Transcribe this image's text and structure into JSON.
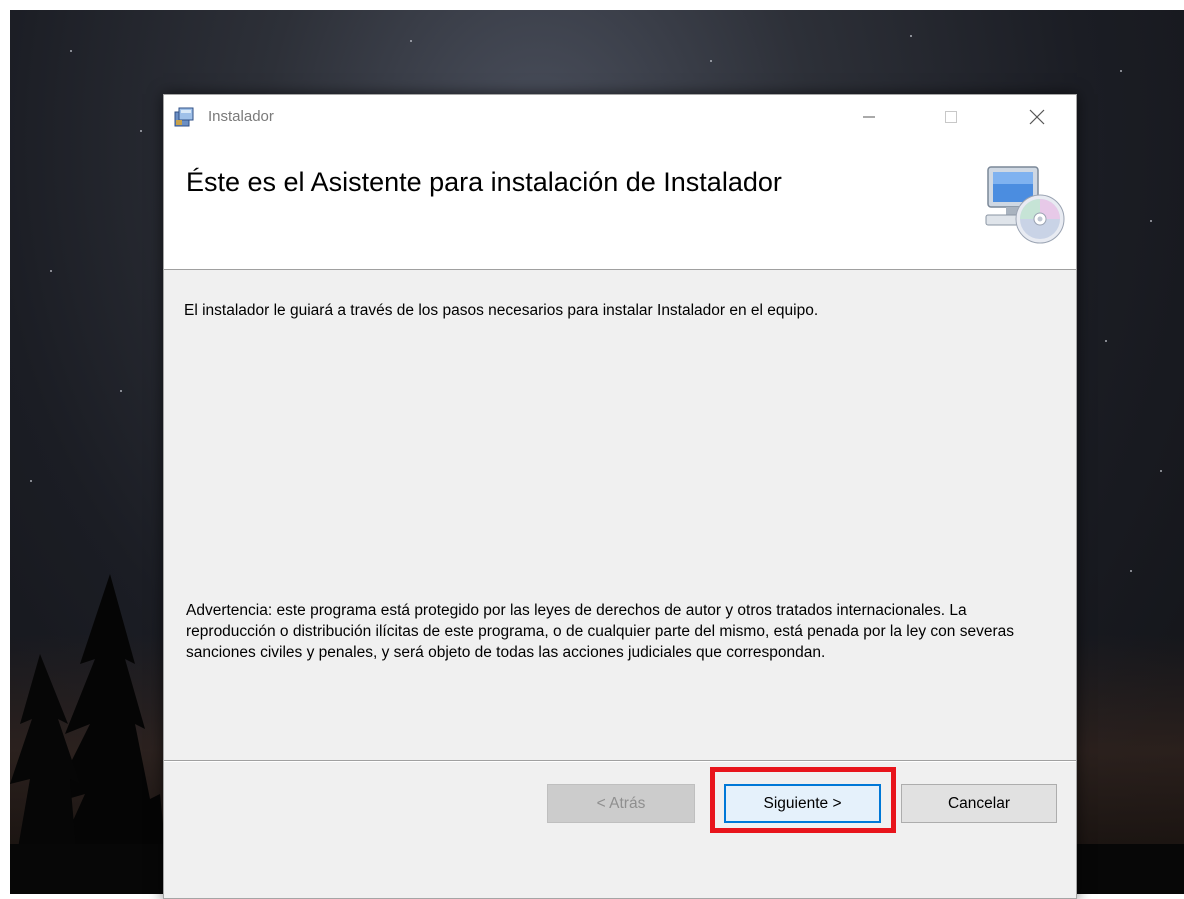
{
  "window": {
    "title": "Instalador",
    "heading": "Éste es el Asistente para instalación de Instalador",
    "intro": "El instalador le guiará a través de los pasos necesarios para instalar Instalador en el equipo.",
    "warning": "Advertencia: este programa está protegido por las leyes de derechos de autor y otros tratados internacionales. La reproducción o distribución ilícitas de este programa, o de cualquier parte del mismo, está penada por la ley con severas sanciones civiles y penales, y será objeto de todas las acciones judiciales que correspondan."
  },
  "buttons": {
    "back": "< Atrás",
    "next": "Siguiente >",
    "cancel": "Cancelar"
  },
  "colors": {
    "highlight": "#e8141b",
    "focus_border": "#0078d7"
  },
  "icons": {
    "app": "installer-package-icon",
    "header": "computer-cd-icon"
  }
}
